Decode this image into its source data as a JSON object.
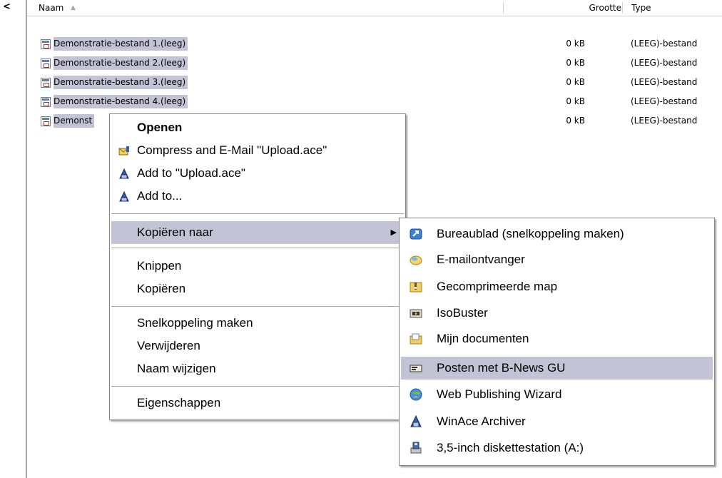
{
  "columns": {
    "name": "Naam",
    "size": "Grootte",
    "type": "Type"
  },
  "files": [
    {
      "name": "Demonstratie-bestand 1.(leeg)",
      "size": "0 kB",
      "type": "(LEEG)-bestand"
    },
    {
      "name": "Demonstratie-bestand 2.(leeg)",
      "size": "0 kB",
      "type": "(LEEG)-bestand"
    },
    {
      "name": "Demonstratie-bestand 3.(leeg)",
      "size": "0 kB",
      "type": "(LEEG)-bestand"
    },
    {
      "name": "Demonstratie-bestand 4.(leeg)",
      "size": "0 kB",
      "type": "(LEEG)-bestand"
    },
    {
      "name": "Demonst",
      "size": "0 kB",
      "type": "(LEEG)-bestand"
    }
  ],
  "context_menu": {
    "open": "Openen",
    "compress_email": "Compress and E-Mail \"Upload.ace\"",
    "add_to_upload": "Add to \"Upload.ace\"",
    "add_to": "Add to...",
    "send_to": "Kopiëren naar",
    "cut": "Knippen",
    "copy": "Kopiëren",
    "create_shortcut": "Snelkoppeling maken",
    "delete": "Verwijderen",
    "rename": "Naam wijzigen",
    "properties": "Eigenschappen"
  },
  "send_to_menu": [
    {
      "label": "Bureaublad (snelkoppeling maken)",
      "icon": "desktop-icon"
    },
    {
      "label": "E-mailontvanger",
      "icon": "mail-recipient-icon"
    },
    {
      "label": "Gecomprimeerde map",
      "icon": "zip-folder-icon"
    },
    {
      "label": "IsoBuster",
      "icon": "isobuster-icon"
    },
    {
      "label": "Mijn documenten",
      "icon": "my-documents-icon"
    },
    {
      "label": "Posten met B-News GU",
      "icon": "bnews-icon"
    },
    {
      "label": "Web Publishing Wizard",
      "icon": "web-publishing-icon"
    },
    {
      "label": "WinAce Archiver",
      "icon": "winace-icon"
    },
    {
      "label": "3,5-inch diskettestation (A:)",
      "icon": "floppy-drive-icon"
    }
  ],
  "highlight_color": "#c3c3d6"
}
